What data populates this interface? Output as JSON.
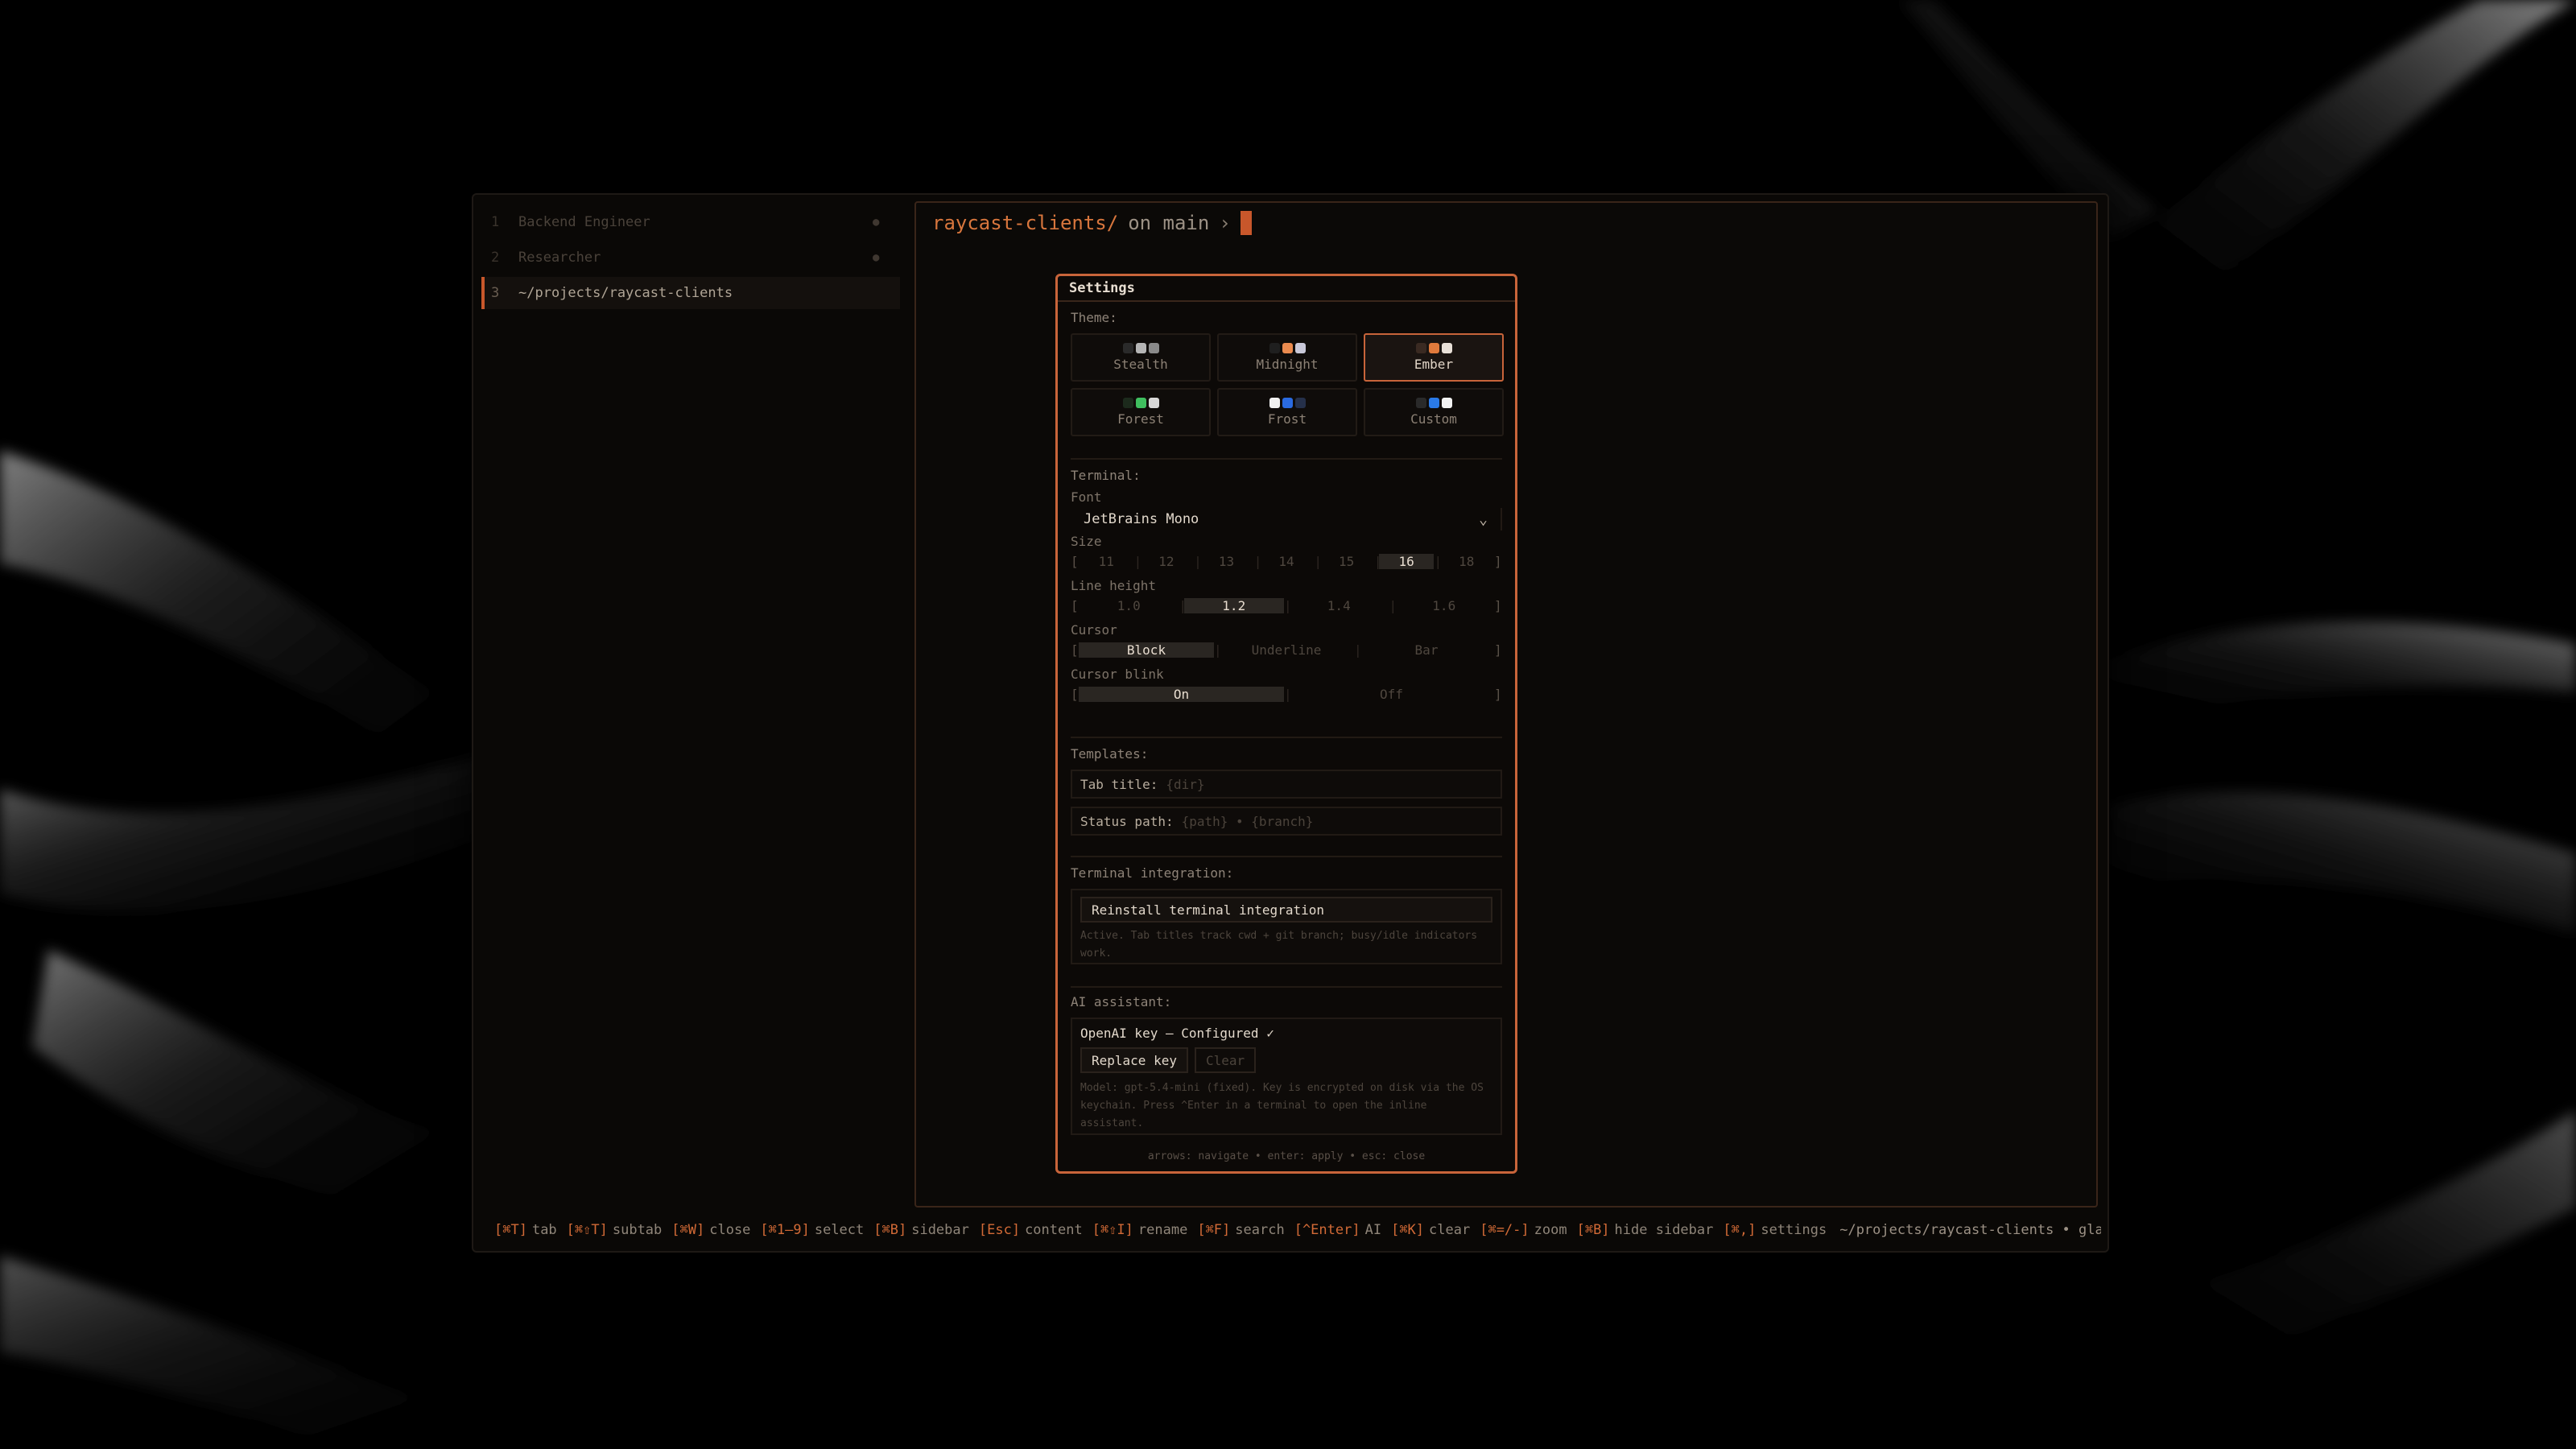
{
  "sidebar": {
    "items": [
      {
        "num": "1",
        "label": "Backend Engineer",
        "dot": "●"
      },
      {
        "num": "2",
        "label": "Researcher",
        "dot": "●"
      },
      {
        "num": "3",
        "label": "~/projects/raycast-clients",
        "dot": ""
      }
    ]
  },
  "terminal": {
    "dir": "raycast-clients/",
    "on_text": "on main",
    "arrow": "›"
  },
  "settings": {
    "title": "Settings",
    "theme_label": "Theme:",
    "themes": [
      {
        "name": "Stealth",
        "colors": [
          "#2a2a2a",
          "#b5b5b5",
          "#8a8a8a"
        ]
      },
      {
        "name": "Midnight",
        "colors": [
          "#1f1f1f",
          "#e98a4f",
          "#c8c8d8"
        ]
      },
      {
        "name": "Ember",
        "colors": [
          "#3a2a22",
          "#e07a3c",
          "#e8e0d8"
        ]
      },
      {
        "name": "Forest",
        "colors": [
          "#1c2a1c",
          "#3fbf5f",
          "#d8d8d8"
        ]
      },
      {
        "name": "Frost",
        "colors": [
          "#f0f0f0",
          "#2a6ae0",
          "#25304a"
        ]
      },
      {
        "name": "Custom",
        "colors": [
          "#2a2a2a",
          "#2a7ae8",
          "#f2f2f2"
        ]
      }
    ],
    "selected_theme": "Ember",
    "terminal_label": "Terminal:",
    "font_label": "Font",
    "font_value": "JetBrains Mono",
    "size_label": "Size",
    "sizes": [
      "11",
      "12",
      "13",
      "14",
      "15",
      "16",
      "18"
    ],
    "selected_size": "16",
    "line_height_label": "Line height",
    "line_heights": [
      "1.0",
      "1.2",
      "1.4",
      "1.6"
    ],
    "selected_line_height": "1.2",
    "cursor_label": "Cursor",
    "cursors": [
      "Block",
      "Underline",
      "Bar"
    ],
    "selected_cursor": "Block",
    "cursor_blink_label": "Cursor blink",
    "blinks": [
      "On",
      "Off"
    ],
    "selected_blink": "On",
    "templates_label": "Templates:",
    "tab_title_label": "Tab title:",
    "tab_title_value": "{dir}",
    "status_path_label": "Status path:",
    "status_path_value": "{path} • {branch}",
    "integration_label": "Terminal integration:",
    "reinstall_label": "Reinstall terminal integration",
    "integration_note": "Active. Tab titles track cwd + git branch; busy/idle indicators work.",
    "ai_label": "AI assistant:",
    "openai_status": "OpenAI key — Configured ✓",
    "replace_key": "Replace key",
    "clear": "Clear",
    "ai_note": "Model: gpt-5.4-mini (fixed). Key is encrypted on disk via the OS keychain. Press ^Enter in a terminal to open the inline assistant.",
    "footer_hint": "arrows: navigate • enter: apply • esc: close"
  },
  "statusbar": {
    "hints": [
      {
        "key": "[⌘T]",
        "label": "tab"
      },
      {
        "key": "[⌘⇧T]",
        "label": "subtab"
      },
      {
        "key": "[⌘W]",
        "label": "close"
      },
      {
        "key": "[⌘1–9]",
        "label": "select"
      },
      {
        "key": "[⌘B]",
        "label": "sidebar"
      },
      {
        "key": "[Esc]",
        "label": "content"
      },
      {
        "key": "[⌘⇧I]",
        "label": "rename"
      },
      {
        "key": "[⌘F]",
        "label": "search"
      },
      {
        "key": "[^Enter]",
        "label": "AI"
      },
      {
        "key": "[⌘K]",
        "label": "clear"
      },
      {
        "key": "[⌘=/-]",
        "label": "zoom"
      },
      {
        "key": "[⌘B]",
        "label": "hide sidebar"
      },
      {
        "key": "[⌘,]",
        "label": "settings"
      }
    ],
    "path": "~/projects/raycast-clients • glaze"
  }
}
